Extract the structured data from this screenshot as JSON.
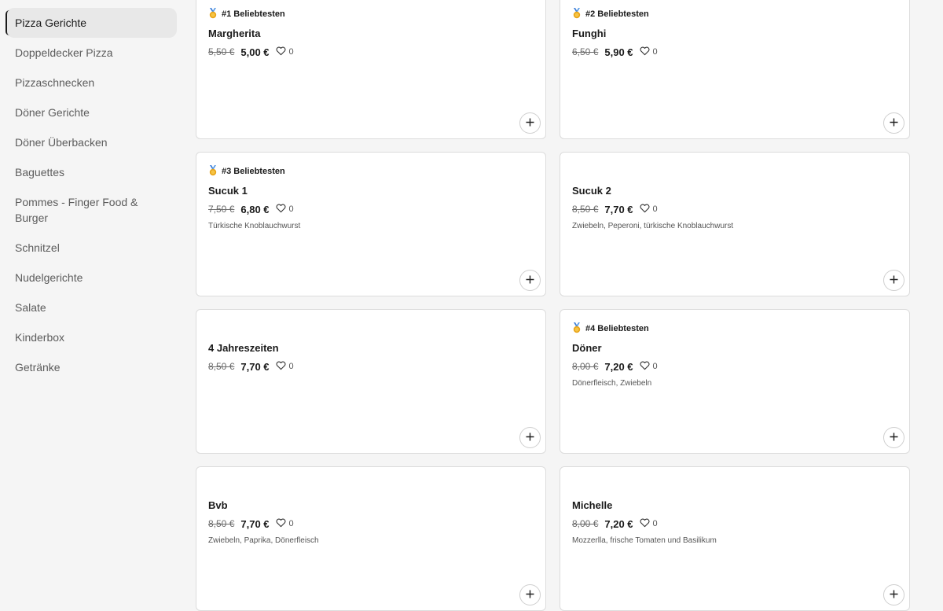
{
  "sidebar": {
    "categories": [
      {
        "label": "Pizza Gerichte",
        "active": true
      },
      {
        "label": "Doppeldecker Pizza",
        "active": false
      },
      {
        "label": "Pizzaschnecken",
        "active": false
      },
      {
        "label": "Döner Gerichte",
        "active": false
      },
      {
        "label": "Döner Überbacken",
        "active": false
      },
      {
        "label": "Baguettes",
        "active": false
      },
      {
        "label": "Pommes - Finger Food & Burger",
        "active": false
      },
      {
        "label": "Schnitzel",
        "active": false
      },
      {
        "label": "Nudelgerichte",
        "active": false
      },
      {
        "label": "Salate",
        "active": false
      },
      {
        "label": "Kinderbox",
        "active": false
      },
      {
        "label": "Getränke",
        "active": false
      }
    ]
  },
  "products": [
    {
      "badge": "#1 Beliebtesten",
      "name": "Margherita",
      "old_price": "5,50 €",
      "price": "5,00 €",
      "likes": "0",
      "description": ""
    },
    {
      "badge": "#2 Beliebtesten",
      "name": "Funghi",
      "old_price": "6,50 €",
      "price": "5,90 €",
      "likes": "0",
      "description": ""
    },
    {
      "badge": "#3 Beliebtesten",
      "name": "Sucuk 1",
      "old_price": "7,50 €",
      "price": "6,80 €",
      "likes": "0",
      "description": "Türkische Knoblauchwurst"
    },
    {
      "badge": "",
      "name": "Sucuk 2",
      "old_price": "8,50 €",
      "price": "7,70 €",
      "likes": "0",
      "description": "Zwiebeln, Peperoni, türkische Knoblauchwurst"
    },
    {
      "badge": "",
      "name": "4 Jahreszeiten",
      "old_price": "8,50 €",
      "price": "7,70 €",
      "likes": "0",
      "description": ""
    },
    {
      "badge": "#4 Beliebtesten",
      "name": "Döner",
      "old_price": "8,00 €",
      "price": "7,20 €",
      "likes": "0",
      "description": "Dönerfleisch, Zwiebeln"
    },
    {
      "badge": "",
      "name": "Bvb",
      "old_price": "8,50 €",
      "price": "7,70 €",
      "likes": "0",
      "description": "Zwiebeln, Paprika, Dönerfleisch"
    },
    {
      "badge": "",
      "name": "Michelle",
      "old_price": "8,00 €",
      "price": "7,20 €",
      "likes": "0",
      "description": "Mozzerlla, frische Tomaten und Basilikum"
    }
  ],
  "colors": {
    "medal": "#e8a317",
    "medal_ribbon": "#3b7dd8",
    "active_bg": "#e8e8e8"
  },
  "icons": {
    "medal": "medal-icon",
    "heart": "heart-icon",
    "add": "plus-icon"
  }
}
